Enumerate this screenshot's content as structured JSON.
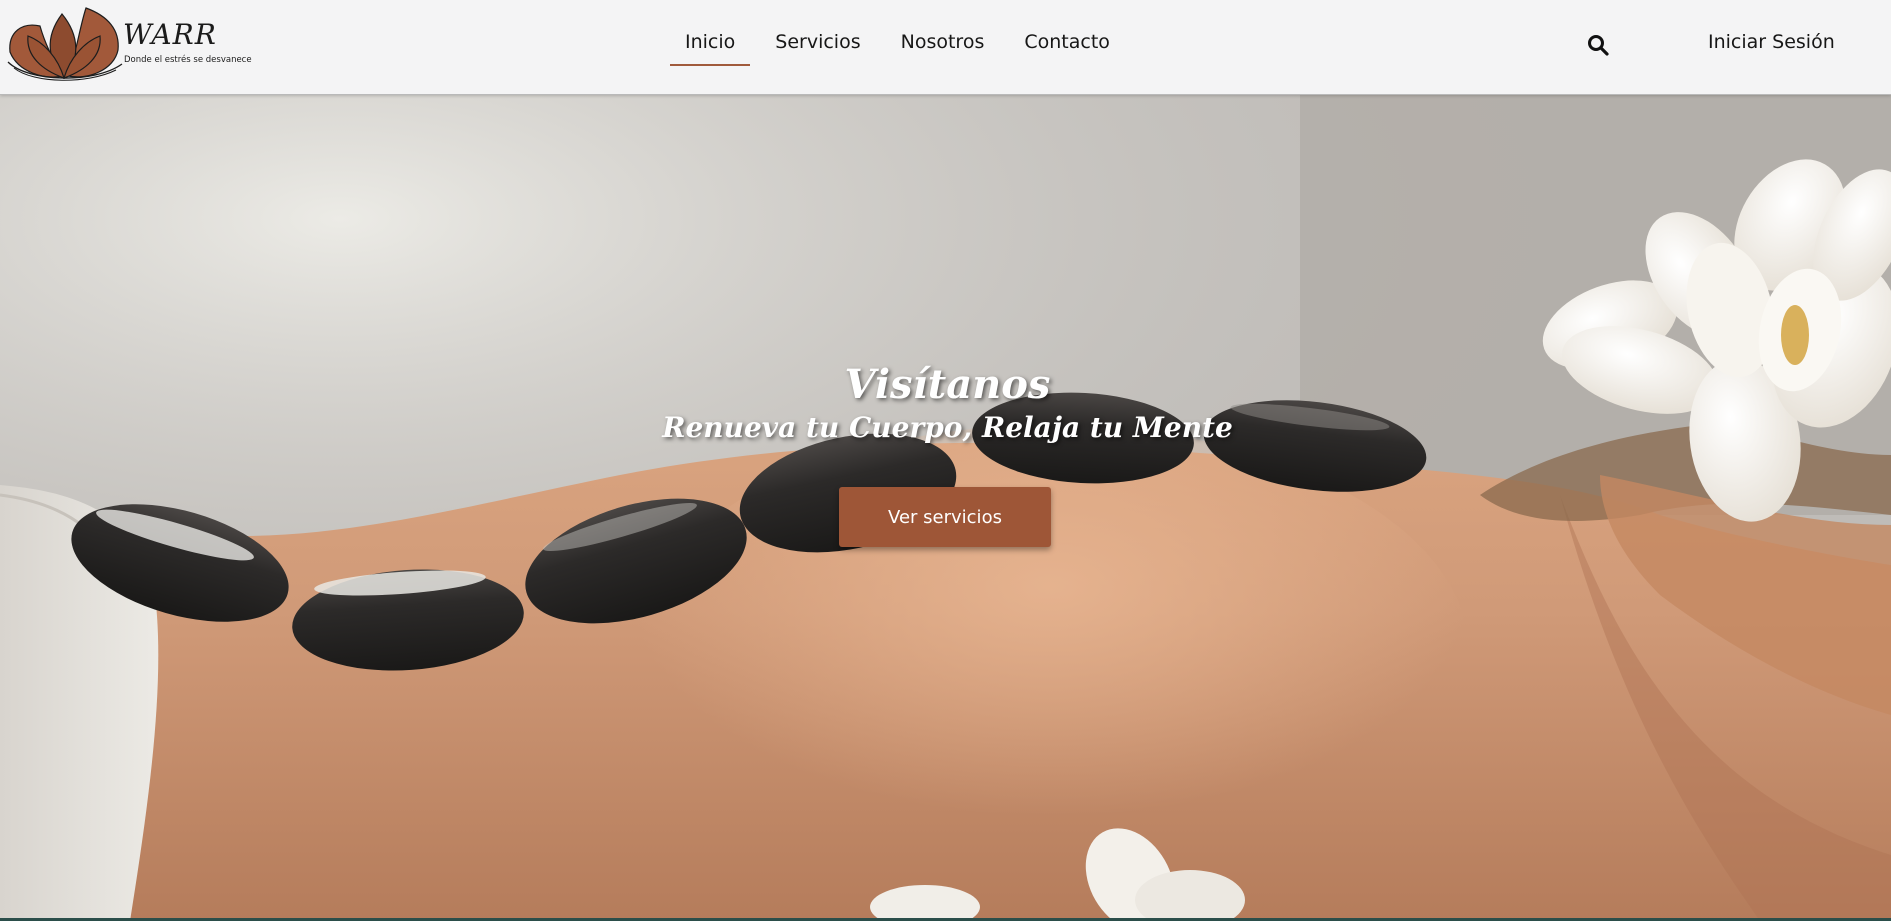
{
  "brand": {
    "name": "WARR",
    "tagline": "Donde el estrés se desvanece",
    "logo_icon": "lotus-icon",
    "accent_color": "#9e5637"
  },
  "nav": {
    "items": [
      {
        "label": "Inicio",
        "active": true
      },
      {
        "label": "Servicios",
        "active": false
      },
      {
        "label": "Nosotros",
        "active": false
      },
      {
        "label": "Contacto",
        "active": false
      }
    ],
    "search_icon": "search-icon",
    "login_label": "Iniciar Sesión"
  },
  "hero": {
    "title": "Visítanos",
    "subtitle": "Renueva tu Cuerpo, Relaja tu Mente",
    "cta_label": "Ver servicios"
  }
}
